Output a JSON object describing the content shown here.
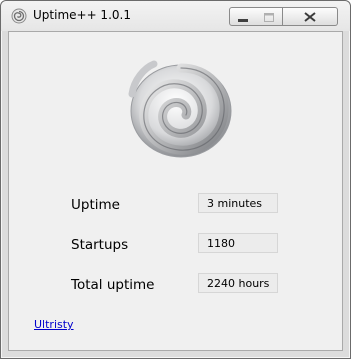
{
  "window": {
    "title": "Uptime++ 1.0.1",
    "controls": {
      "minimize_icon": "minimize-icon",
      "maximize_icon": "maximize-icon",
      "close_icon": "close-icon"
    }
  },
  "logo": {
    "icon": "swirl-logo"
  },
  "stats": {
    "uptime": {
      "label": "Uptime",
      "value": "3 minutes"
    },
    "startups": {
      "label": "Startups",
      "value": "1180"
    },
    "total_uptime": {
      "label": "Total uptime",
      "value": "2240 hours"
    }
  },
  "footer": {
    "link_text": "Ultristy",
    "link_color": "#0000cc"
  }
}
